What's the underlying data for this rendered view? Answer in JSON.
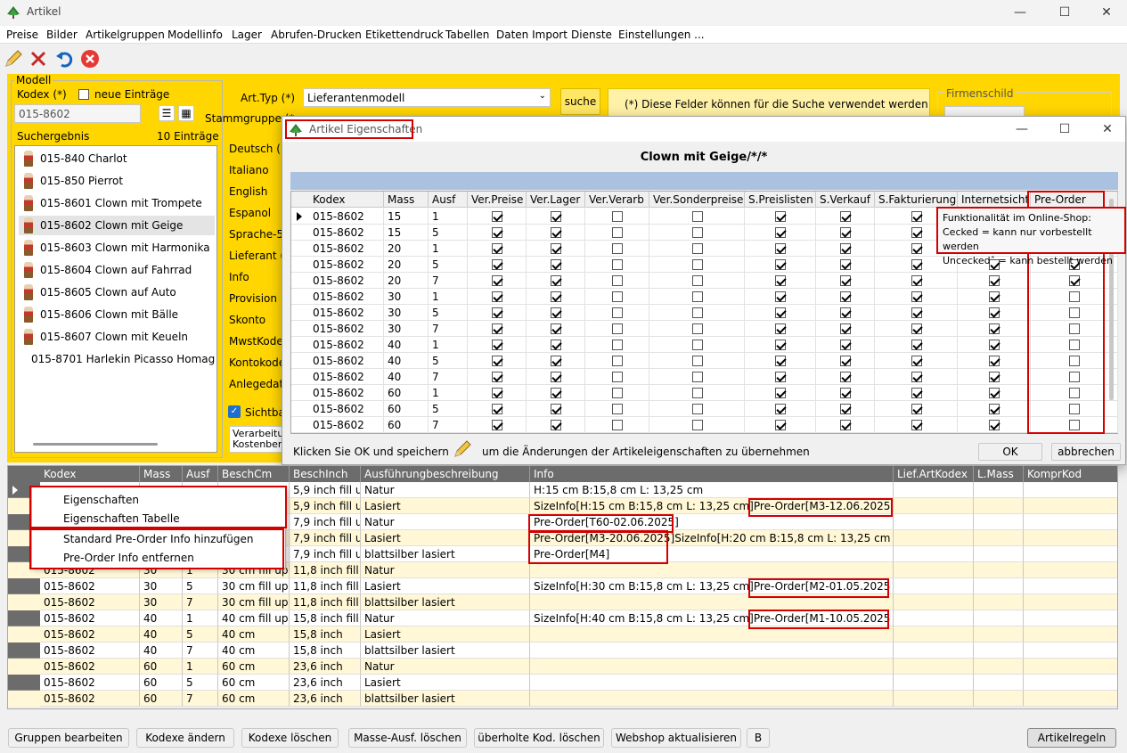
{
  "window": {
    "title": "Artikel"
  },
  "menu": [
    "Preise",
    "Bilder",
    "Artikelgruppen",
    "Modellinfo",
    "Lager",
    "Abrufen-Drucken",
    "Etikettendruck",
    "Tabellen",
    "Daten Import",
    "Dienste",
    "Einstellungen ..."
  ],
  "toolbar": {
    "icons": [
      "pencil-icon",
      "delete-x-icon",
      "undo-icon",
      "close-circle-icon"
    ]
  },
  "modell": {
    "group_label": "Modell",
    "kodex_label": "Kodex (*)",
    "neue_label": "neue Einträge",
    "kodex_value": "015-8602",
    "suchergebnis_label": "Suchergebnis",
    "count_label": "10 Einträge",
    "items": [
      "015-840 Charlot",
      "015-850 Pierrot",
      "015-8601 Clown mit Trompete",
      "015-8602 Clown mit Geige",
      "015-8603 Clown mit Harmonika",
      "015-8604 Clown auf Fahrrad",
      "015-8605 Clown auf Auto",
      "015-8606 Clown mit Bälle",
      "015-8607 Clown mit Keueln",
      "015-8701 Harlekin Picasso Homag"
    ],
    "selected_index": 3
  },
  "form": {
    "arttyp_label": "Art.Typ (*)",
    "arttyp_value": "Lieferantenmodell",
    "stammgruppe_label": "Stammgruppe (*",
    "suche_label": "suche",
    "hint": "(*) Diese Felder können für die Suche verwendet werden",
    "firmenschild_label": "Firmenschild",
    "fields": [
      "Deutsch (",
      "Italiano",
      "English",
      "Espanol",
      "Sprache-5",
      "Lieferant (",
      "Info",
      "Provision",
      "Skonto",
      "MwstKodex",
      "Kontokode",
      "Anlegedatu"
    ],
    "sichtbar_label": "Sichtba",
    "verarbeitung_text": "Verarbeitu Kostenber"
  },
  "dialog": {
    "title": "Artikel Eigenschaften",
    "heading": "Clown mit Geige/*/*",
    "columns": [
      "Kodex",
      "Mass",
      "Ausf",
      "Ver.Preise",
      "Ver.Lager",
      "Ver.Verarb",
      "Ver.Sonderpreise",
      "S.Preislisten",
      "S.Verkauf",
      "S.Fakturierung",
      "Internetsicht.",
      "Pre-Order"
    ],
    "rows": [
      {
        "kodex": "015-8602",
        "mass": "15",
        "ausf": "1",
        "checks": [
          1,
          1,
          0,
          0,
          1,
          1,
          1,
          1,
          1
        ]
      },
      {
        "kodex": "015-8602",
        "mass": "15",
        "ausf": "5",
        "checks": [
          1,
          1,
          0,
          0,
          1,
          1,
          1,
          1,
          1
        ]
      },
      {
        "kodex": "015-8602",
        "mass": "20",
        "ausf": "1",
        "checks": [
          1,
          1,
          0,
          0,
          1,
          1,
          1,
          1,
          1
        ]
      },
      {
        "kodex": "015-8602",
        "mass": "20",
        "ausf": "5",
        "checks": [
          1,
          1,
          0,
          0,
          1,
          1,
          1,
          1,
          1
        ]
      },
      {
        "kodex": "015-8602",
        "mass": "20",
        "ausf": "7",
        "checks": [
          1,
          1,
          0,
          0,
          1,
          1,
          1,
          1,
          1
        ]
      },
      {
        "kodex": "015-8602",
        "mass": "30",
        "ausf": "1",
        "checks": [
          1,
          1,
          0,
          0,
          1,
          1,
          1,
          1,
          0
        ]
      },
      {
        "kodex": "015-8602",
        "mass": "30",
        "ausf": "5",
        "checks": [
          1,
          1,
          0,
          0,
          1,
          1,
          1,
          1,
          0
        ]
      },
      {
        "kodex": "015-8602",
        "mass": "30",
        "ausf": "7",
        "checks": [
          1,
          1,
          0,
          0,
          1,
          1,
          1,
          1,
          0
        ]
      },
      {
        "kodex": "015-8602",
        "mass": "40",
        "ausf": "1",
        "checks": [
          1,
          1,
          0,
          0,
          1,
          1,
          1,
          1,
          0
        ]
      },
      {
        "kodex": "015-8602",
        "mass": "40",
        "ausf": "5",
        "checks": [
          1,
          1,
          0,
          0,
          1,
          1,
          1,
          1,
          0
        ]
      },
      {
        "kodex": "015-8602",
        "mass": "40",
        "ausf": "7",
        "checks": [
          1,
          1,
          0,
          0,
          1,
          1,
          1,
          1,
          0
        ]
      },
      {
        "kodex": "015-8602",
        "mass": "60",
        "ausf": "1",
        "checks": [
          1,
          1,
          0,
          0,
          1,
          1,
          1,
          1,
          0
        ]
      },
      {
        "kodex": "015-8602",
        "mass": "60",
        "ausf": "5",
        "checks": [
          1,
          1,
          0,
          0,
          1,
          1,
          1,
          1,
          0
        ]
      },
      {
        "kodex": "015-8602",
        "mass": "60",
        "ausf": "7",
        "checks": [
          1,
          1,
          0,
          0,
          1,
          1,
          1,
          1,
          0
        ]
      }
    ],
    "tooltip": [
      "Funktionalität im Online-Shop:",
      "Cecked = kann nur vorbestellt werden",
      "Unceckedˆ = kann bestellt werden"
    ],
    "footer_pre": "Klicken Sie OK und speichern",
    "footer_post": "um die Änderungen der Artikeleigenschaften zu übernehmen",
    "ok_label": "OK",
    "cancel_label": "abbrechen"
  },
  "lower_table": {
    "columns": [
      "Kodex",
      "Mass",
      "Ausf",
      "BeschCm",
      "BeschInch",
      "Ausführungbeschreibung",
      "Info",
      "Lief.ArtKodex",
      "L.Mass",
      "KomprKod"
    ],
    "rows": [
      {
        "kodex": "",
        "mass": "",
        "ausf": "",
        "cm": "",
        "inch": "5,9 inch fill u",
        "beschr": "Natur",
        "info": "H:15 cm  B:15,8 cm L: 13,25 cm"
      },
      {
        "kodex": "",
        "mass": "",
        "ausf": "",
        "cm": "",
        "inch": "5,9 inch fill u",
        "beschr": "Lasiert",
        "info": "SizeInfo[H:15 cm  B:15,8 cm L: 13,25 cm]Pre-Order[M3-12.06.2025"
      },
      {
        "kodex": "",
        "mass": "",
        "ausf": "",
        "cm": "",
        "inch": "7,9 inch fill u",
        "beschr": "Natur",
        "info": "Pre-Order[T60-02.06.2025]"
      },
      {
        "kodex": "",
        "mass": "",
        "ausf": "",
        "cm": "",
        "inch": "7,9 inch fill u",
        "beschr": "Lasiert",
        "info": "Pre-Order[M3-20.06.2025]SizeInfo[H:20 cm  B:15,8 cm L: 13,25 cm"
      },
      {
        "kodex": "",
        "mass": "",
        "ausf": "",
        "cm": "",
        "inch": "7,9 inch fill u",
        "beschr": "blattsilber lasiert",
        "info": "Pre-Order[M4]"
      },
      {
        "kodex": "015-8602",
        "mass": "30",
        "ausf": "1",
        "cm": "30 cm fill up",
        "inch": "11,8 inch fill",
        "beschr": "Natur",
        "info": ""
      },
      {
        "kodex": "015-8602",
        "mass": "30",
        "ausf": "5",
        "cm": "30 cm fill up",
        "inch": "11,8 inch fill",
        "beschr": "Lasiert",
        "info": "SizeInfo[H:30 cm  B:15,8 cm L: 13,25 cm]Pre-Order[M2-01.05.2025"
      },
      {
        "kodex": "015-8602",
        "mass": "30",
        "ausf": "7",
        "cm": "30 cm fill up",
        "inch": "11,8 inch fill",
        "beschr": "blattsilber lasiert",
        "info": ""
      },
      {
        "kodex": "015-8602",
        "mass": "40",
        "ausf": "1",
        "cm": "40 cm fill up",
        "inch": "15,8 inch fill",
        "beschr": "Natur",
        "info": "SizeInfo[H:40 cm  B:15,8 cm L: 13,25 cm]Pre-Order[M1-10.05.2025"
      },
      {
        "kodex": "015-8602",
        "mass": "40",
        "ausf": "5",
        "cm": "40 cm",
        "inch": "15,8 inch",
        "beschr": "Lasiert",
        "info": ""
      },
      {
        "kodex": "015-8602",
        "mass": "40",
        "ausf": "7",
        "cm": "40 cm",
        "inch": "15,8 inch",
        "beschr": "blattsilber lasiert",
        "info": ""
      },
      {
        "kodex": "015-8602",
        "mass": "60",
        "ausf": "1",
        "cm": "60 cm",
        "inch": "23,6 inch",
        "beschr": "Natur",
        "info": ""
      },
      {
        "kodex": "015-8602",
        "mass": "60",
        "ausf": "5",
        "cm": "60 cm",
        "inch": "23,6 inch",
        "beschr": "Lasiert",
        "info": ""
      },
      {
        "kodex": "015-8602",
        "mass": "60",
        "ausf": "7",
        "cm": "60 cm",
        "inch": "23,6 inch",
        "beschr": "blattsilber lasiert",
        "info": ""
      }
    ]
  },
  "context_menu": [
    "Eigenschaften",
    "Eigenschaften Tabelle",
    "Standard Pre-Order Info hinzufügen",
    "Pre-Order Info entfernen"
  ],
  "bottom_buttons": [
    "Gruppen bearbeiten",
    "Kodexe ändern",
    "Kodexe löschen",
    "Masse-Ausf. löschen",
    "überholte Kod. löschen",
    "Webshop aktualisieren",
    "B",
    "Artikelregeln"
  ],
  "colors": {
    "accent_yellow": "#ffd600",
    "highlight_red": "#d40000",
    "header_gray": "#6c6c6c",
    "row_yellow": "#fff7d6"
  }
}
